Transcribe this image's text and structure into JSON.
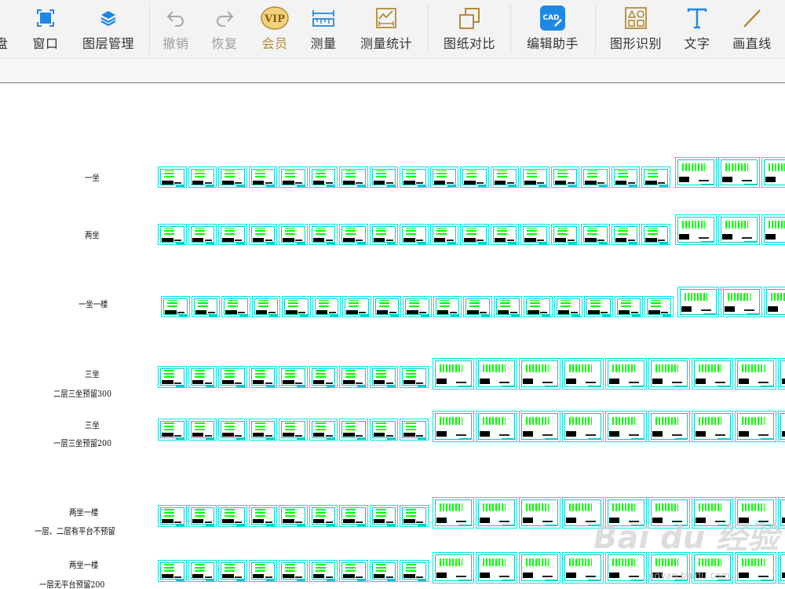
{
  "toolbar": {
    "items": [
      {
        "key": "partial",
        "label": "盘",
        "icon": "disk-icon",
        "state": "normal"
      },
      {
        "key": "window",
        "label": "窗口",
        "icon": "window-icon",
        "state": "normal"
      },
      {
        "key": "layers",
        "label": "图层管理",
        "icon": "layers-icon",
        "state": "normal"
      },
      {
        "key": "undo",
        "label": "撤销",
        "icon": "undo-icon",
        "state": "disabled"
      },
      {
        "key": "redo",
        "label": "恢复",
        "icon": "redo-icon",
        "state": "disabled"
      },
      {
        "key": "vip",
        "label": "会员",
        "badge": "VIP",
        "icon": "vip-icon",
        "state": "vip"
      },
      {
        "key": "measure",
        "label": "测量",
        "icon": "ruler-icon",
        "state": "normal"
      },
      {
        "key": "measure_stats",
        "label": "测量统计",
        "icon": "chart-ruler-icon",
        "state": "normal"
      },
      {
        "key": "compare",
        "label": "图纸对比",
        "icon": "compare-icon",
        "state": "normal"
      },
      {
        "key": "edit_helper",
        "label": "编辑助手",
        "badge": "CAD",
        "icon": "cad-edit-icon",
        "state": "normal"
      },
      {
        "key": "shape_recognition",
        "label": "图形识别",
        "icon": "shapes-icon",
        "state": "normal"
      },
      {
        "key": "text",
        "label": "文字",
        "icon": "text-icon",
        "state": "normal"
      },
      {
        "key": "line",
        "label": "画直线",
        "icon": "line-icon",
        "state": "normal"
      }
    ]
  },
  "drawing": {
    "rows": [
      {
        "label1": "一坐",
        "label2": ""
      },
      {
        "label1": "两坐",
        "label2": ""
      },
      {
        "label1": "一坐一楼",
        "label2": ""
      },
      {
        "label1": "三坐",
        "label2": "二层三坐预留300"
      },
      {
        "label1": "三坐",
        "label2": "一层三坐预留200"
      },
      {
        "label1": "两坐一楼",
        "label2": "一层、二层有平台不预留"
      },
      {
        "label1": "两坐一楼",
        "label2": "一层无平台预留200"
      }
    ]
  },
  "watermark": {
    "text": "Bai du 经验",
    "sub": "jingyan.baidu.com"
  },
  "colors": {
    "sheet_border": "#00e5e5",
    "accent_blue": "#1e88e5",
    "vip_gold": "#b48a33",
    "green_lines": "#00ff00"
  }
}
